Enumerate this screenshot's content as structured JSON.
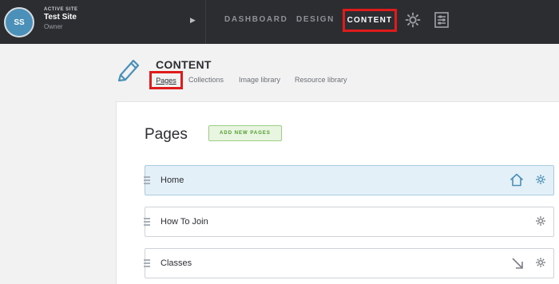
{
  "topbar": {
    "site": {
      "initials": "SS",
      "kicker": "ACTIVE SITE",
      "name": "Test Site",
      "role": "Owner",
      "toggle_icon": "caret-right-icon"
    },
    "nav": {
      "dashboard": "DASHBOARD",
      "design": "DESIGN",
      "content": "CONTENT",
      "settings_icon": "gear-icon",
      "dashboard_icon": "sliders-panel-icon"
    }
  },
  "header": {
    "title": "CONTENT",
    "icon": "pencil-icon",
    "subnav": {
      "pages": "Pages",
      "collections": "Collections",
      "images": "Image library",
      "resources": "Resource library"
    }
  },
  "main": {
    "heading": "Pages",
    "add_button": "ADD NEW PAGES",
    "rows": [
      {
        "label": "Home",
        "icons": [
          "home-icon",
          "gear-icon"
        ],
        "highlighted": true
      },
      {
        "label": "How To Join",
        "icons": [
          "gear-icon"
        ],
        "highlighted": false
      },
      {
        "label": "Classes",
        "icons": [
          "arrow-down-right-icon",
          "gear-icon"
        ],
        "highlighted": false
      }
    ]
  },
  "colors": {
    "topbar_bg": "#2b2d31",
    "highlight_border": "#e01b1b",
    "accent_blue": "#4a90b8",
    "add_button_green": "#4e9a2c"
  }
}
